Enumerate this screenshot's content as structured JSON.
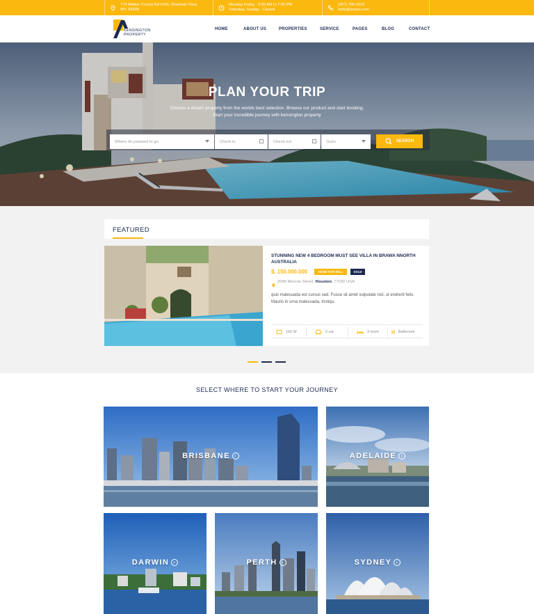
{
  "topbar": {
    "address_line1": "774 Walker County Rd #241, Mountain View,",
    "address_line2": "WY, 83939",
    "hours_line1": "Monday-Friday : 9:00 AM to 7:00 PM",
    "hours_line2": "Saturday, Sunday : Closed",
    "phone": "(307) 760-2619",
    "email": "hello@tonjoo.com"
  },
  "brand": {
    "line1": "KENSINGTON",
    "line2": "PROPERTY"
  },
  "nav": [
    "HOME",
    "ABOUT US",
    "PROPERTIES",
    "SERVICE",
    "PAGES",
    "BLOG",
    "CONTACT"
  ],
  "hero": {
    "title": "PLAN YOUR TRIP",
    "subtitle_line1": "Choose a dream property from the worlds best selection. Browse our product and start booking.",
    "subtitle_line2": "Start your incredible journey with kensington property"
  },
  "search": {
    "destination_placeholder": "Where do youwant to go",
    "checkin_placeholder": "Check in",
    "checkout_placeholder": "Check out",
    "guests_placeholder": "Gues",
    "button_label": "SEARCH"
  },
  "featured": {
    "heading": "FEATURED",
    "title": "STUNNING NEW 4 BEDROOM MUST SEE VILLA IN BRAWA NNORTH AUSTRALIA",
    "price": "$. 150.000.000",
    "badge_sell": "HOME FOR SELL",
    "badge_sold": "SOLD",
    "address_street": "2096 Monroe Street,",
    "address_city": "Houston",
    "address_zip": ", 77030 USA",
    "description": "quis malesuada est cursus sed. Fusce sit amet vulputate nisl, ut endrerit felis. Mauris in urna malesuada, tristiqu.",
    "stats": {
      "area": "100 Sf",
      "car": "2 car",
      "room": "3 room",
      "bath": "Bathroom"
    }
  },
  "slider": {
    "active_index": 0,
    "count": 3
  },
  "destinations": {
    "heading": "SELECT WHERE TO START YOUR JOURNEY",
    "cities": [
      "BRISBANE",
      "ADELAIDE",
      "DARWIN",
      "PERTH",
      "SYDNEY"
    ]
  },
  "colors": {
    "accent": "#fbb80f",
    "navy": "#1c2a52"
  }
}
